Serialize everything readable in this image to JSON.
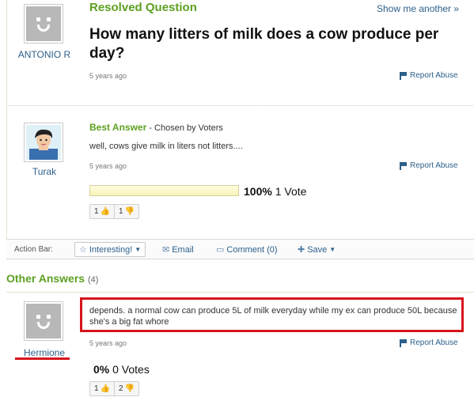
{
  "question": {
    "status": "Resolved Question",
    "show_another": "Show me another »",
    "title": "How many litters of milk does a cow produce per day?",
    "asker": "ANTONIO R",
    "time": "5 years ago",
    "report": "Report Abuse"
  },
  "best_answer": {
    "label": "Best Answer",
    "chosen": " - Chosen by Voters",
    "text": "well, cows give milk in liters not litters....",
    "user": "Turak",
    "time": "5 years ago",
    "report": "Report Abuse",
    "vote_pct": "100%",
    "vote_count": "1 Vote",
    "vote_fraction": 1.0,
    "thumbs_up": "1",
    "thumbs_down": "1"
  },
  "action_bar": {
    "label": "Action Bar:",
    "interesting": "Interesting!",
    "email": "Email",
    "comment": "Comment (0)",
    "save": "Save"
  },
  "other_answers": {
    "heading": "Other Answers",
    "count": "(4)",
    "items": [
      {
        "user": "Hermione",
        "text": "depends. a normal cow can produce 5L of milk everyday while my ex can produce 50L because she's a big fat whore",
        "time": "5 years ago",
        "report": "Report Abuse",
        "vote_pct": "0%",
        "vote_count": "0 Votes",
        "thumbs_up": "1",
        "thumbs_down": "2"
      }
    ]
  },
  "colors": {
    "accent_green": "#5da021",
    "link_blue": "#2b5f8a",
    "highlight_red": "#d6141c"
  }
}
